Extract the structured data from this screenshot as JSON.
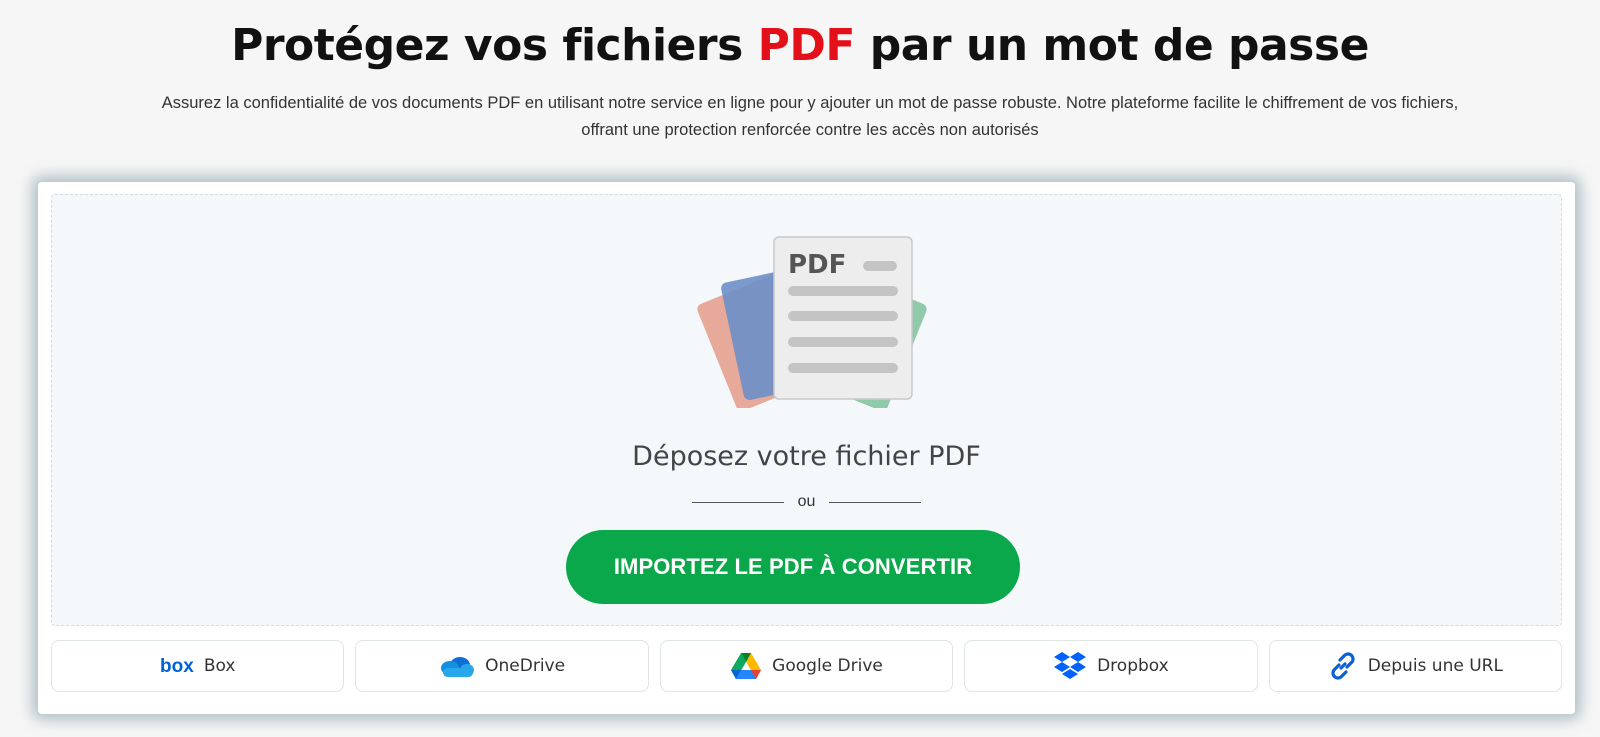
{
  "header": {
    "title_before": "Protégez vos fichiers ",
    "title_highlight": "PDF",
    "title_after": " par un mot de passe",
    "subtitle_line1": "Assurez la confidentialité de vos documents PDF en utilisant notre service en ligne pour y ajouter un mot de passe robuste. Notre plateforme facilite le chiffrement de vos fichiers,",
    "subtitle_line2": "offrant une protection renforcée contre les accès non autorisés"
  },
  "upload": {
    "illustration_text": "PDF",
    "drop_label": "Déposez votre fichier PDF",
    "or_text": "ou",
    "button_label": "IMPORTEZ LE PDF À CONVERTIR"
  },
  "sources": [
    {
      "label": "Box",
      "icon": "box-icon"
    },
    {
      "label": "OneDrive",
      "icon": "onedrive-icon"
    },
    {
      "label": "Google Drive",
      "icon": "google-drive-icon"
    },
    {
      "label": "Dropbox",
      "icon": "dropbox-icon"
    },
    {
      "label": "Depuis une URL",
      "icon": "link-icon"
    }
  ],
  "colors": {
    "accent_red": "#e3101a",
    "button_green": "#0aa84b",
    "icon_blue": "#0061d5"
  }
}
